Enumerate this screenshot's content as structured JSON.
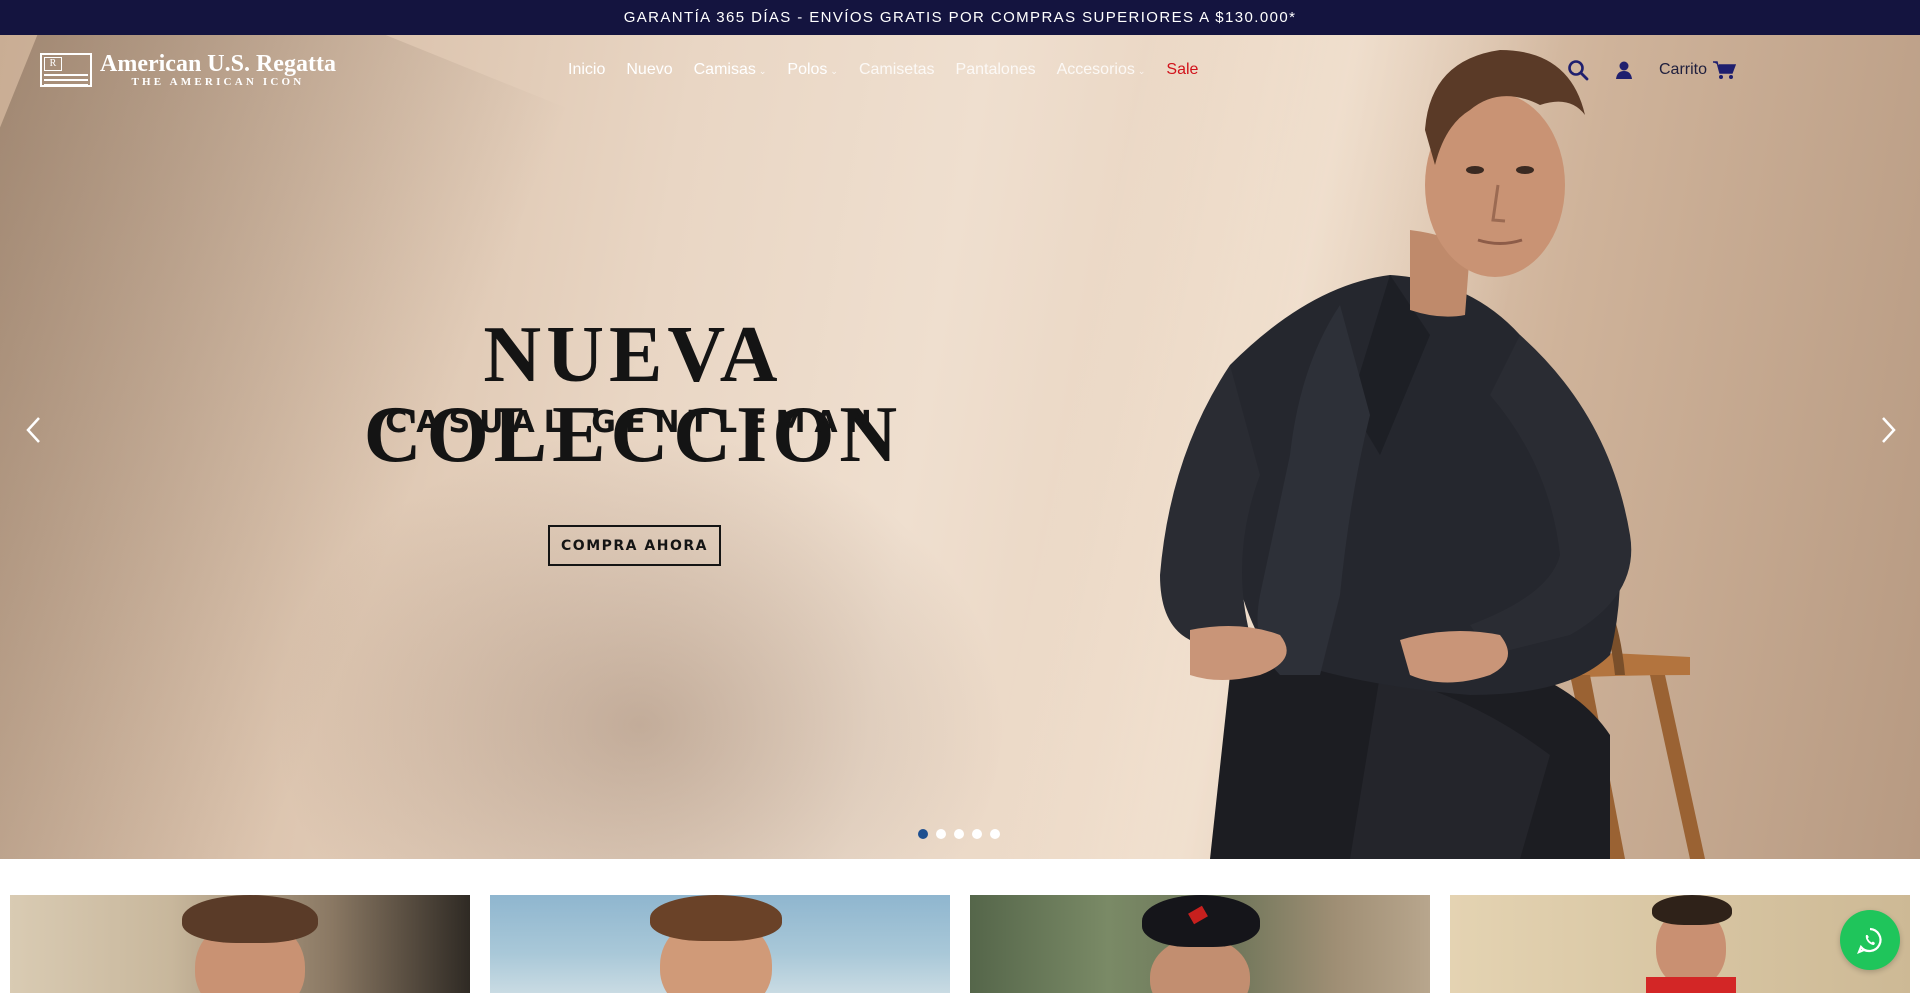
{
  "announcement": "GARANTÍA 365 DÍAS - ENVÍOS GRATIS POR COMPRAS SUPERIORES A $130.000*",
  "brand": {
    "name": "American U.S. Regatta",
    "tagline": "THE AMERICAN ICON",
    "flag_letter": "R"
  },
  "nav": {
    "items": [
      {
        "label": "Inicio",
        "has_dropdown": false
      },
      {
        "label": "Nuevo",
        "has_dropdown": false
      },
      {
        "label": "Camisas",
        "has_dropdown": true
      },
      {
        "label": "Polos",
        "has_dropdown": true
      },
      {
        "label": "Camisetas",
        "has_dropdown": false
      },
      {
        "label": "Pantalones",
        "has_dropdown": false
      },
      {
        "label": "Accesorios",
        "has_dropdown": true
      },
      {
        "label": "Sale",
        "has_dropdown": false
      }
    ],
    "cart_label": "Carrito",
    "icons": [
      "search-icon",
      "user-icon",
      "cart-icon",
      "chevron-down-icon"
    ]
  },
  "hero": {
    "title": "NUEVA COLECCION",
    "subtitle": "CASUAL GENTLEMAN",
    "cta": "COMPRA AHORA",
    "slide_count": 5,
    "active_slide": 1,
    "icons": [
      "chevron-left-icon",
      "chevron-right-icon"
    ]
  },
  "floating": {
    "icon": "whatsapp-icon"
  },
  "colors": {
    "announcement_bg": "#14143f",
    "accent": "#1f1f6e",
    "sale": "#d1121b",
    "active_dot": "#1e4f8f",
    "whatsapp": "#1fc55b"
  }
}
